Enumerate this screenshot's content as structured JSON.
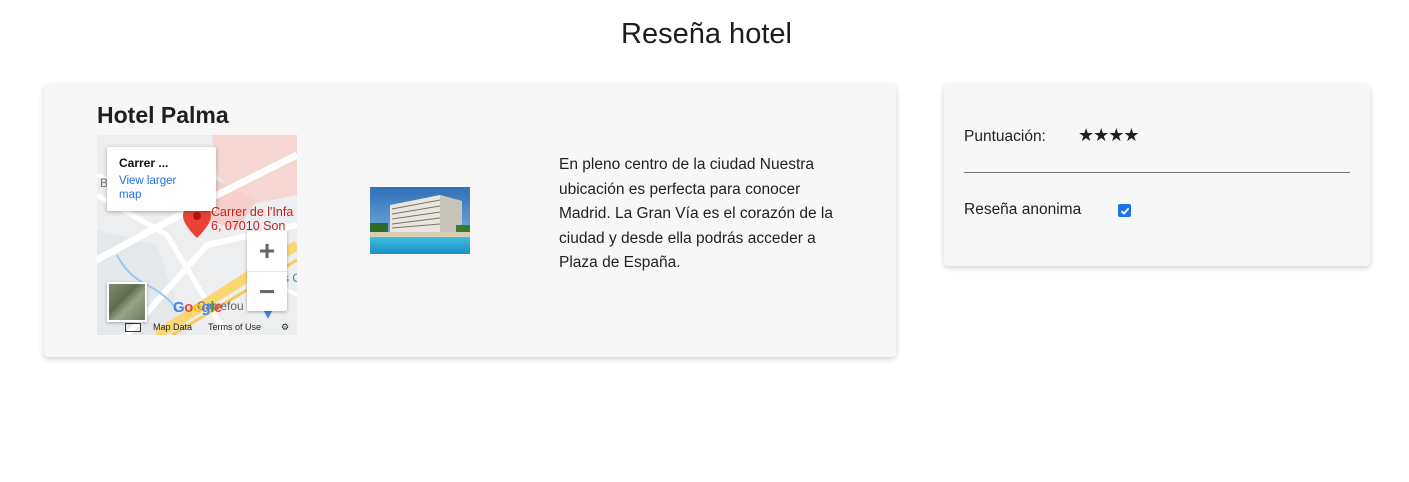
{
  "page": {
    "title": "Reseña hotel"
  },
  "hotel": {
    "name": "Hotel Palma",
    "description": "En pleno centro de la ciudad Nuestra ubicación es perfecta para conocer Madrid. La Gran Vía es el corazón de la ciudad y desde ella podrás acceder a Plaza de España."
  },
  "map": {
    "info_place": "Carrer ...",
    "view_larger": "View larger map",
    "marker_label_line1": "Carrer de l'Infa",
    "marker_label_line2": "6, 07010 Son",
    "zoom_in": "+",
    "zoom_out": "−",
    "google_logo": "Google",
    "map_data": "Map Data",
    "terms": "Terms of Use",
    "street_label": "Carrefour",
    "partial_text_b": "B",
    "partial_text_s": "s C"
  },
  "review": {
    "rating_label": "Puntuación:",
    "rating_value": 4,
    "rating_max": 4,
    "stars_text": "★★★★",
    "anonymous_label": "Reseña anonima",
    "anonymous_checked": true
  },
  "colors": {
    "card_bg": "#f7f7f7",
    "link_blue": "#1a73e8",
    "marker_red": "#ea4335",
    "label_red": "#c5221f"
  }
}
